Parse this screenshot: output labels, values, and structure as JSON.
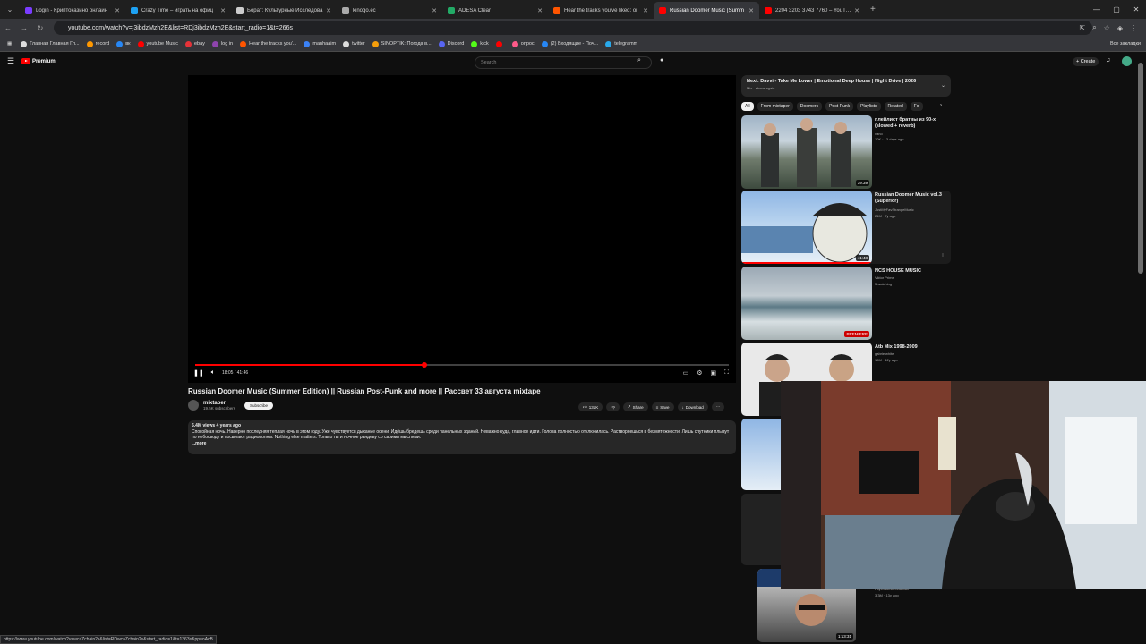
{
  "browser": {
    "tabs": [
      {
        "title": "Login - Криптоказино онлайн",
        "color": "#7a3cff"
      },
      {
        "title": "Crazy Time – играть на офиц",
        "color": "#1da1f2"
      },
      {
        "title": "Борат: Культурные Исследова",
        "color": "#cccccc"
      },
      {
        "title": "kinogo.ec",
        "color": "#aaaaaa"
      },
      {
        "title": "ADESA Clear",
        "color": "#2a6"
      },
      {
        "title": "Hear the tracks you've liked: or",
        "color": "#ff5500"
      },
      {
        "title": "Russian Doomer Music (Summ",
        "color": "#ff0000"
      },
      {
        "title": "2204 3203 3743 7760 – YouTub",
        "color": "#ff0000"
      }
    ],
    "active_tab": 6,
    "url": "youtube.com/watch?v=j3ibdzMzh2E&list=RDj3ibdzMzh2E&start_radio=1&t=266s",
    "bookmarks": [
      {
        "label": "Главная Главная Гл...",
        "color": "#ddd"
      },
      {
        "label": "record",
        "color": "#ff9800"
      },
      {
        "label": "вк",
        "color": "#2787f5"
      },
      {
        "label": "youtube Music",
        "color": "#ff0000"
      },
      {
        "label": "ebay",
        "color": "#e53238"
      },
      {
        "label": "log in",
        "color": "#8e44ad"
      },
      {
        "label": "Hear the tracks you'...",
        "color": "#ff5500"
      },
      {
        "label": "manhaaim",
        "color": "#3b82f6"
      },
      {
        "label": "twitter",
        "color": "#ddd"
      },
      {
        "label": "SINOPTIK: Погода в...",
        "color": "#f59e0b"
      },
      {
        "label": "Discord",
        "color": "#5865f2"
      },
      {
        "label": "kick",
        "color": "#53fc18"
      },
      {
        "label": "",
        "color": "#ff0000"
      },
      {
        "label": "опрос",
        "color": "#ff5a8a"
      },
      {
        "label": "(2) Входящие - Поч...",
        "color": "#2787f5"
      },
      {
        "label": "telegramm",
        "color": "#29a9eb"
      }
    ],
    "all_bookmarks": "Все закладки",
    "status_url": "https://www.youtube.com/watch?v=wcaZcbain2s&list=RDwcaZcbain2s&start_radio=1&t=1363s&pp=oAcB"
  },
  "youtube": {
    "logo": "Premium",
    "search_placeholder": "Search",
    "create": "Create"
  },
  "player": {
    "time": "18:05 / 41:46",
    "progress": 0.43
  },
  "video": {
    "title": "Russian Doomer Music (Summer Edition) || Russian Post-Punk and more || Рассвет 33 августа mixtape",
    "channel": "mixtaper",
    "subscribers": "19.5K subscribers",
    "subscribe": "Subscribe",
    "likes": "131K",
    "share": "Share",
    "save": "Save",
    "download": "Download",
    "views": "5.4M views  4 years ago",
    "description": "Спокойная ночь. Наверно последняя теплая ночь в этом году. Уже чувствуется дыхание осени. Идёшь бредешь среди панельных зданий. Неважно куда, главное идти. Голова полностью отключилась. Растворяешься в безмятежности. Лишь спутники плывут по небосводу и посылают радиоволны. Nothing else matters. Только ты и ночное рандеву со своими мыслями.",
    "more": "...more"
  },
  "sidebar": {
    "next_title": "Next: Davvi - Take Me Lower | Emotional Deep House | Night Drive | 2026",
    "next_sub": "Mix - shove again",
    "chips": [
      "All",
      "From mixtaper",
      "Doomers",
      "Post-Punk",
      "Playlists",
      "Related",
      "Fo"
    ],
    "recs": [
      {
        "title": "плейлист братвы из 90-х (slowed + reverb)",
        "line1": "vano",
        "line2": "10K · 13 days ago",
        "duration": "39:39"
      },
      {
        "title": "Russian Doomer Music vol.3 (Superior)",
        "line1": "JustMyFavStrangeMusic",
        "line2": "21M · 7y ago",
        "duration": "41:48"
      },
      {
        "title": "NCS HOUSE MUSIC",
        "line1": "Viktor Prime",
        "line2": "5 watching",
        "duration": "PREMIERE"
      },
      {
        "title": "Atb Mix 1998-2009",
        "line1": "gabrielwhite",
        "line2": "15M · 12y ago",
        "duration": ""
      },
      {
        "title": "",
        "line1": "Psychadelicbreakfast",
        "line2": "3.3M · 13y ago",
        "duration": "1:13:31"
      }
    ]
  }
}
